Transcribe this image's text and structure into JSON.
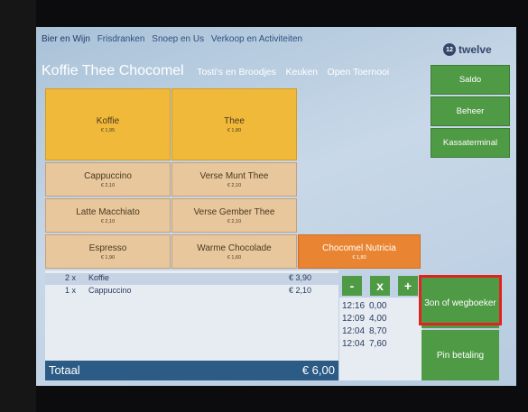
{
  "top_nav": [
    "Bier en Wijn",
    "Frisdranken",
    "Snoep en Us",
    "Verkoop en Activiteiten"
  ],
  "sub_nav": {
    "active": "Koffie Thee Chocomel",
    "items": [
      "Tosti's en Broodjes",
      "Keuken",
      "Open Toernooi"
    ]
  },
  "logo": {
    "text": "twelve",
    "mark": "12"
  },
  "side_buttons": [
    "Saldo",
    "Beheer",
    "Kassaterminal"
  ],
  "products": [
    {
      "name": "Koffie",
      "price": "€ 1,95"
    },
    {
      "name": "Thee",
      "price": "€ 1,80"
    },
    {
      "name": "Cappuccino",
      "price": "€ 2,10"
    },
    {
      "name": "Verse Munt Thee",
      "price": "€ 2,10"
    },
    {
      "name": "Latte Macchiato",
      "price": "€ 2,10"
    },
    {
      "name": "Verse Gember Thee",
      "price": "€ 2,10"
    },
    {
      "name": "Espresso",
      "price": "€ 1,90"
    },
    {
      "name": "Warme Chocolade",
      "price": "€ 1,60"
    },
    {
      "name": "Chocomel Nutricia",
      "price": "€ 1,80"
    }
  ],
  "order": {
    "rows": [
      {
        "qty": "2 x",
        "item": "Koffie",
        "price": "€ 3,90"
      },
      {
        "qty": "1 x",
        "item": "Cappuccino",
        "price": "€ 2,10"
      }
    ],
    "total_label": "Totaal",
    "total": "€ 6,00"
  },
  "controls": {
    "minus": "-",
    "remove": "x",
    "plus": "+"
  },
  "transactions": [
    {
      "time": "12:16",
      "amount": "0,00"
    },
    {
      "time": "12:09",
      "amount": "4,00"
    },
    {
      "time": "12:04",
      "amount": "8,70"
    },
    {
      "time": "12:04",
      "amount": "7,60"
    }
  ],
  "actions": {
    "bon": "3on of wegboeker",
    "pin": "Pin betaling"
  },
  "colors": {
    "green": "#4f9a45",
    "yellow_tile": "#f0b93a",
    "tan_tile": "#e8c79c",
    "orange_tile": "#e98532",
    "highlight": "#e1231f",
    "total_bar": "#2c5b85"
  }
}
